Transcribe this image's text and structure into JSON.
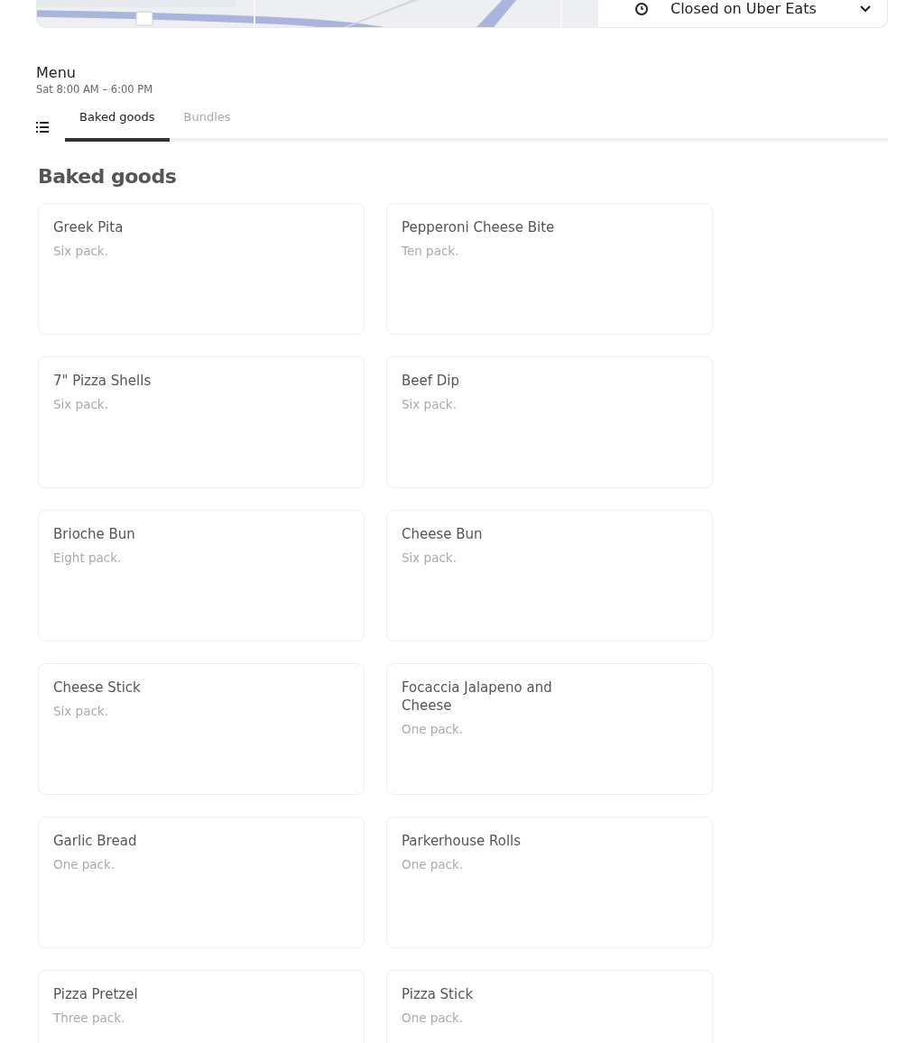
{
  "store_status": {
    "label": "Closed on Uber Eats"
  },
  "menu": {
    "title": "Menu",
    "hours": "Sat 8:00 AM – 6:00 PM"
  },
  "tabs": [
    {
      "label": "Baked goods",
      "selected": true
    },
    {
      "label": "Bundles",
      "selected": false
    }
  ],
  "section": {
    "title": "Baked goods",
    "items": [
      {
        "name": "Greek Pita",
        "description": "Six pack."
      },
      {
        "name": "Pepperoni Cheese Bite",
        "description": "Ten pack."
      },
      {
        "name": "7\" Pizza Shells",
        "description": "Six pack."
      },
      {
        "name": "Beef Dip",
        "description": "Six pack."
      },
      {
        "name": "Brioche Bun",
        "description": "Eight pack."
      },
      {
        "name": "Cheese Bun",
        "description": "Six pack."
      },
      {
        "name": "Cheese Stick",
        "description": "Six pack."
      },
      {
        "name": "Focaccia Jalapeno and Cheese",
        "description": "One pack."
      },
      {
        "name": "Garlic Bread",
        "description": "One pack."
      },
      {
        "name": "Parkerhouse Rolls",
        "description": "One pack."
      },
      {
        "name": "Pizza Pretzel",
        "description": "Three pack."
      },
      {
        "name": "Pizza Stick",
        "description": "One pack."
      }
    ]
  }
}
